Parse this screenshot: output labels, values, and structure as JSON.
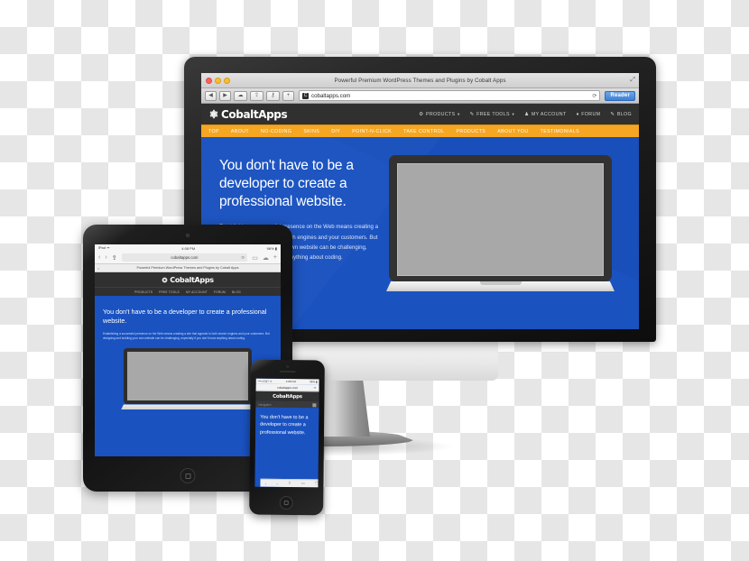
{
  "scene": {
    "title": "Responsive web design device mockup",
    "brand_blue": "#1a52c0",
    "brand_orange": "#f5a623",
    "header_dark": "#303030"
  },
  "desktop": {
    "browser": {
      "window_title": "Powerful Premium WordPress Themes and Plugins by Cobalt Apps",
      "url": "cobaltapps.com",
      "reader_label": "Reader",
      "back_icon": "◀",
      "forward_icon": "▶",
      "cloud_icon": "☁",
      "share_icon": "⇪",
      "tools_icon": "⚷",
      "add_tab_icon": "+",
      "reload_icon": "⟳",
      "resize_icon": "⤢",
      "traffic_lights": [
        "close",
        "minimize",
        "zoom"
      ]
    },
    "site": {
      "logo_text": "CobaltApps",
      "logo_icon": "gear-icon",
      "top_nav": [
        {
          "label": "PRODUCTS",
          "icon": "⚙",
          "caret": "▾"
        },
        {
          "label": "FREE TOOLS",
          "icon": "🔧",
          "caret": "▾"
        },
        {
          "label": "MY ACCOUNT",
          "icon": "👤",
          "caret": ""
        },
        {
          "label": "FORUM",
          "icon": "👥",
          "caret": ""
        },
        {
          "label": "BLOG",
          "icon": "✎",
          "caret": ""
        }
      ],
      "sub_nav": [
        "TOP",
        "ABOUT",
        "NO-CODING",
        "SKINS",
        "DIY",
        "POINT-N-CLICK",
        "TAKE CONTROL",
        "PRODUCTS",
        "ABOUT YOU",
        "TESTIMONIALS"
      ],
      "hero_heading": "You don't have to be a developer to create a professional website.",
      "hero_paragraph": "Establishing a successful presence on the Web means creating a site that appeals to both search engines and your customers. But designing and building your own website can be challenging, especially if you don't know anything about coding."
    }
  },
  "tablet": {
    "status_left": "iPad ᯤ",
    "status_center": "4:08 PM",
    "status_right": "96% ▮",
    "browser": {
      "back_icon": "‹",
      "forward_icon": "›",
      "share_icon": "⇪",
      "url": "cobaltapps.com",
      "reload_icon": "⟳",
      "bookmarks_icon": "▭",
      "cloud_icon": "☁",
      "new_tab_icon": "+",
      "tab_title": "Powerful Premium WordPress Themes and Plugins by Cobalt Apps",
      "tab_close_icon": "×"
    },
    "site": {
      "logo_text": "CobaltApps",
      "nav": [
        {
          "label": "PRODUCTS",
          "icon": "⚙"
        },
        {
          "label": "FREE TOOLS",
          "icon": "🔧"
        },
        {
          "label": "MY ACCOUNT",
          "icon": "👤"
        },
        {
          "label": "FORUM",
          "icon": "👥"
        },
        {
          "label": "BLOG",
          "icon": "✎"
        }
      ],
      "hero_heading": "You don't have to be a developer to create a professional website.",
      "hero_paragraph": "Establishing a successful presence on the Web means creating a site that appeals to both search engines and your customers. But designing and building your own website can be challenging, especially if you don't know anything about coding."
    }
  },
  "phone": {
    "status_left": "•••• AT&T ᯤ",
    "status_center": "4:08 PM",
    "status_right": "96% ▮",
    "browser": {
      "url": "cobaltapps.com",
      "reload_icon": "⟳",
      "back_icon": "‹",
      "forward_icon": "›",
      "share_icon": "⇪",
      "bookmarks_icon": "▭",
      "tabs_icon": "❐"
    },
    "site": {
      "logo_text": "CobaltApps",
      "nav_label": "Navigation",
      "menu_icon": "menu-icon",
      "hero_heading": "You don't have to be a developer to create a professional website."
    }
  }
}
